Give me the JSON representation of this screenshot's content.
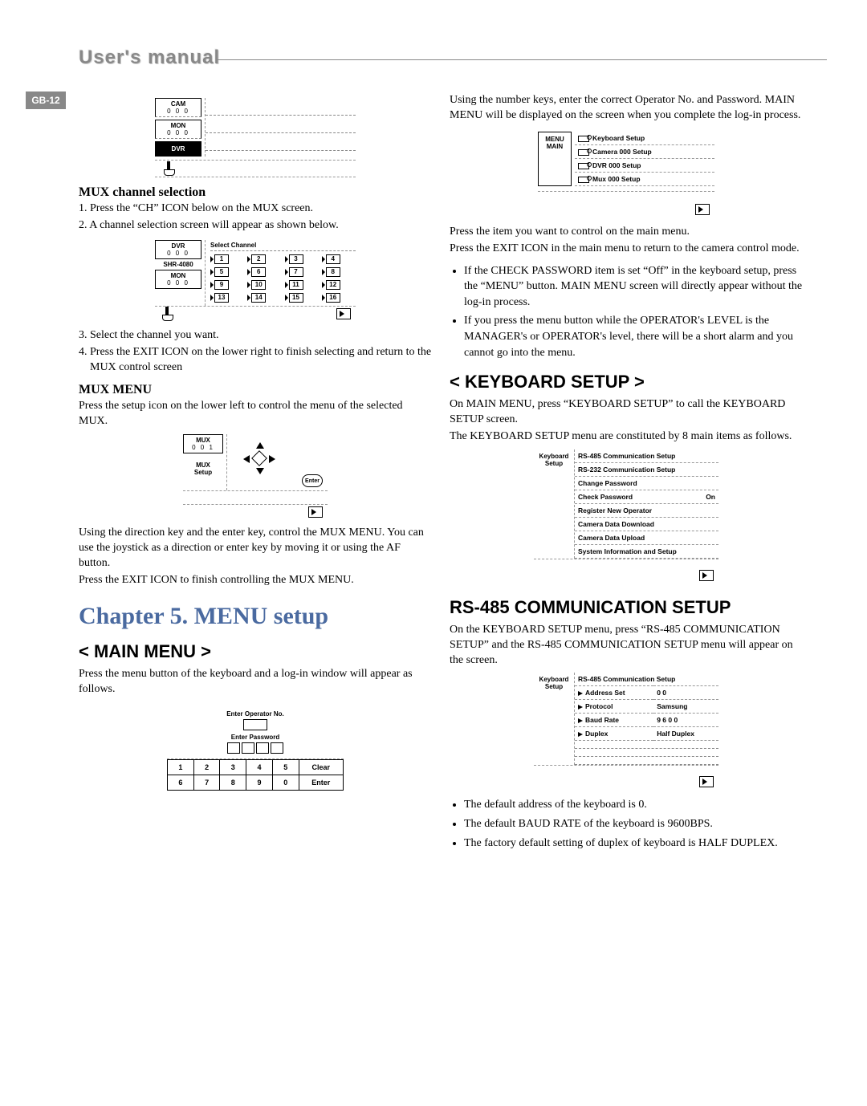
{
  "header": {
    "title": "User's manual",
    "page_num": "GB-12"
  },
  "left": {
    "diagram1": {
      "cam": "CAM",
      "cam_num": "0 0 0",
      "mon": "MON",
      "mon_num": "0 0 0",
      "dvr": "DVR"
    },
    "mux_sel_heading": "MUX channel selection",
    "mux_sel_steps": [
      "1. Press the “CH” ICON below on the MUX screen.",
      "2. A channel selection screen will appear as shown below."
    ],
    "diagram2": {
      "dvr": "DVR",
      "dvr_num": "0 0 0",
      "shr": "SHR-4080",
      "mon": "MON",
      "mon_num": "0 0 0",
      "title": "Select Channel",
      "ch": [
        "1",
        "2",
        "3",
        "4",
        "5",
        "6",
        "7",
        "8",
        "9",
        "10",
        "11",
        "12",
        "13",
        "14",
        "15",
        "16"
      ]
    },
    "mux_sel_steps2": [
      "3. Select the channel you want.",
      "4. Press the EXIT ICON on the lower right to finish selecting and return to the MUX control screen"
    ],
    "mux_menu_heading": "MUX MENU",
    "mux_menu_para": "Press the setup icon on the lower left to control the menu of the selected MUX.",
    "diagram3": {
      "mux": "MUX",
      "mux_num": "0 0 1",
      "setup": "MUX\nSetup",
      "enter": "Enter"
    },
    "mux_menu_para2": "Using the direction key and the enter key, control the MUX MENU. You can use the joystick as a direction or enter key by moving it or using the AF button.",
    "mux_menu_para3": "Press the EXIT ICON to finish controlling the MUX MENU.",
    "chapter": "Chapter 5. MENU setup",
    "main_menu_heading": "< MAIN MENU >",
    "main_menu_para": "Press the menu button of the keyboard and a log-in window will appear as follows.",
    "diagram4": {
      "op": "Enter Operator No.",
      "pw": "Enter Password",
      "keys": [
        "1",
        "2",
        "3",
        "4",
        "5",
        "Clear",
        "6",
        "7",
        "8",
        "9",
        "0",
        "Enter"
      ]
    }
  },
  "right": {
    "intro": "Using the number keys, enter the correct Operator No. and Password. MAIN MENU will be displayed on the screen when you complete the log-in process.",
    "diagram5": {
      "menu": "MENU\nMAIN",
      "items": [
        "Keyboard Setup",
        "Camera 000 Setup",
        "DVR 000 Setup",
        "Mux 000 Setup"
      ]
    },
    "press_item": "Press the item you want to control on the main menu.",
    "press_exit": "Press the EXIT ICON in the main menu to return to the camera control mode.",
    "bullets": [
      "If the CHECK PASSWORD item is set “Off” in the keyboard setup, press the “MENU” button. MAIN MENU screen will directly appear without the log-in process.",
      "If you press the menu button while the OPERATOR's LEVEL is the MANAGER's or OPERATOR's level, there will be a short alarm and you cannot go into the menu."
    ],
    "kb_setup_heading": "< KEYBOARD SETUP >",
    "kb_setup_para": "On MAIN MENU, press “KEYBOARD SETUP” to call the KEYBOARD SETUP screen.",
    "kb_setup_para2": "The KEYBOARD SETUP menu are constituted by 8 main items as follows.",
    "diagram6": {
      "label": "Keyboard\nSetup",
      "items": [
        "RS-485 Communication Setup",
        "RS-232 Communication Setup",
        "Change Password",
        "Check Password",
        "Register New Operator",
        "Camera Data Download",
        "Camera Data Upload",
        "System Information and Setup"
      ],
      "check_pw_val": "On"
    },
    "rs485_heading": "RS-485 COMMUNICATION SETUP",
    "rs485_para": "On the KEYBOARD SETUP menu, press “RS-485 COMMUNICATION SETUP” and the RS-485 COMMUNICATION SETUP menu will appear on the screen.",
    "diagram7": {
      "label": "Keyboard\nSetup",
      "title": "RS-485 Communication Setup",
      "rows": [
        {
          "k": "Address Set",
          "v": "0 0"
        },
        {
          "k": "Protocol",
          "v": "Samsung"
        },
        {
          "k": "Baud Rate",
          "v": "9 6 0 0"
        },
        {
          "k": "Duplex",
          "v": "Half Duplex"
        }
      ]
    },
    "rs485_bullets": [
      "The default address of the keyboard is 0.",
      "The default BAUD RATE of the keyboard is 9600BPS.",
      "The factory default setting of duplex of keyboard is HALF DUPLEX."
    ]
  }
}
